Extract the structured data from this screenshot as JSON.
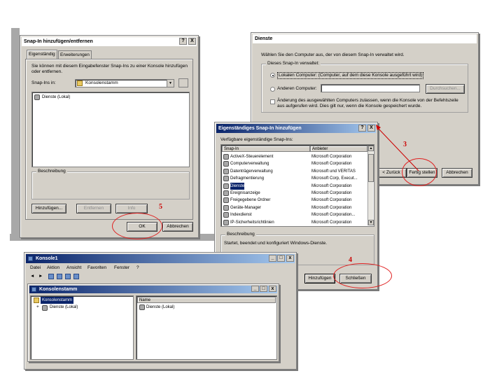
{
  "dialog_snapin": {
    "title": "Snap-In hinzufügen/entfernen",
    "tabs": [
      "Eigenständig",
      "Erweiterungen"
    ],
    "description_text": "Sie können mit diesem Eingabefenster Snap-Ins zu einer Konsole hinzufügen oder entfernen.",
    "snapins_label": "Snap-Ins in:",
    "snapins_select": "Konsolenstamm",
    "list_item": "Dienste (Lokal)",
    "group_label": "Beschreibung",
    "btn_add": "Hinzufügen...",
    "btn_remove": "Entfernen",
    "btn_about": "Info",
    "btn_ok": "OK",
    "btn_cancel": "Abbrechen",
    "help_btn": "?",
    "close_btn": "X"
  },
  "dialog_dienste": {
    "title": "Dienste",
    "prompt": "Wählen Sie den Computer aus, der von diesem Snap-In verwaltet wird.",
    "group_label": "Dieses Snap-In verwaltet:",
    "radio_local": "Lokalen Computer: (Computer, auf dem diese Konsole ausgeführt wird)",
    "radio_other": "Anderen Computer:",
    "btn_browse": "Durchsuchen...",
    "checkbox_text": "Änderung des ausgewählten Computers zulassen, wenn die Konsole von der Befehlszeile aus aufgerufen wird. Dies gilt nur, wenn die Konsole gespeichert wurde.",
    "btn_finish": "Fertig stellen",
    "btn_cancel": "Abbrechen",
    "btn_back": "< Zurück"
  },
  "dialog_standalone": {
    "title": "Eigenständiges Snap-In hinzufügen",
    "list_caption": "Verfügbare eigenständige Snap-Ins:",
    "col_snapin": "Snap-In",
    "col_vendor": "Anbieter",
    "rows": [
      {
        "name": "ActiveX-Steuerelement",
        "vendor": "Microsoft Corporation"
      },
      {
        "name": "Computerverwaltung",
        "vendor": "Microsoft Corporation"
      },
      {
        "name": "Datenträgerverwaltung",
        "vendor": "Microsoft und VERITAS"
      },
      {
        "name": "Defragmentierung",
        "vendor": "Microsoft Corp, Execut..."
      },
      {
        "name": "Dienste",
        "vendor": "Microsoft Corporation"
      },
      {
        "name": "Ereignisanzeige",
        "vendor": "Microsoft Corporation"
      },
      {
        "name": "Freigegebene Ordner",
        "vendor": "Microsoft Corporation"
      },
      {
        "name": "Geräte-Manager",
        "vendor": "Microsoft Corporation"
      },
      {
        "name": "Indexdienst",
        "vendor": "Microsoft Corporation..."
      },
      {
        "name": "IP-Sicherheitsrichtlinien",
        "vendor": "Microsoft Corporation"
      }
    ],
    "selected_index": 4,
    "group_label": "Beschreibung",
    "description": "Startet, beendet und konfiguriert Windows-Dienste.",
    "btn_add": "Hinzufügen",
    "btn_close": "Schließen",
    "help_btn": "?",
    "close_btn": "X"
  },
  "console": {
    "title": "Konsole1",
    "menu": [
      "Datei",
      "Aktion",
      "Ansicht",
      "Favoriten",
      "Fenster",
      "?"
    ],
    "inner_title": "Konsolenstamm",
    "tree_root": "Konsolenstamm",
    "tree_child": "Dienste (Lokal)",
    "col_name": "Name",
    "right_item": "Dienste (Lokal)"
  },
  "callouts": {
    "c3": "3",
    "c4": "4",
    "c5": "5"
  },
  "colors": {
    "dialog_bg": "#d4d0c8",
    "titlebar_blue": "#0a246a",
    "selection": "#0a246a",
    "annotation_red": "#cc0000"
  }
}
